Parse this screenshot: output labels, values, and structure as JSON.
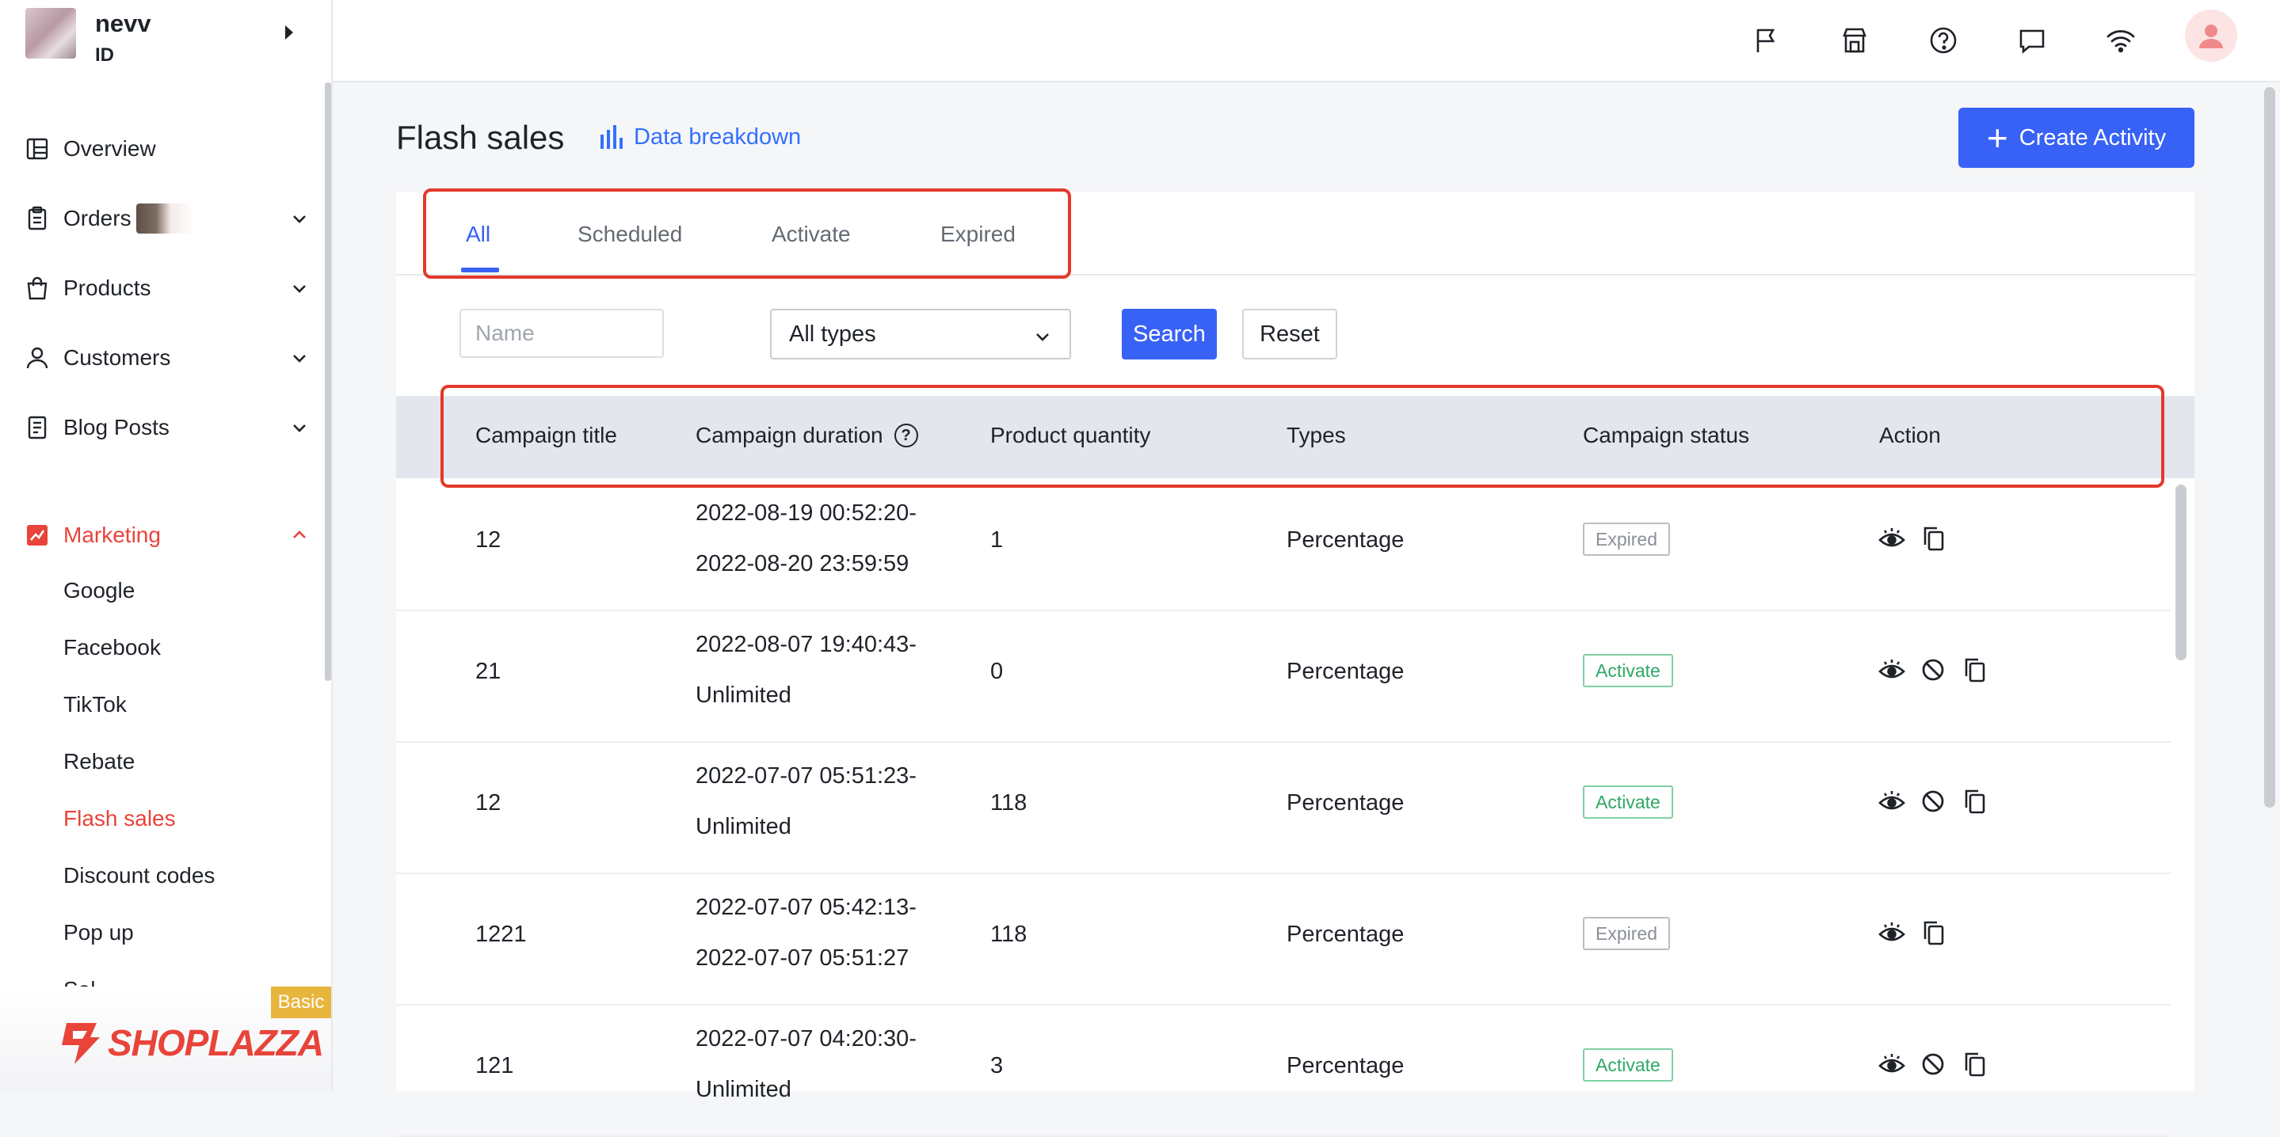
{
  "store": {
    "name": "nevv",
    "id_label": "ID"
  },
  "sidebar": {
    "items": [
      {
        "label": "Overview",
        "icon": "overview-icon"
      },
      {
        "label": "Orders",
        "icon": "orders-icon"
      },
      {
        "label": "Products",
        "icon": "products-icon"
      },
      {
        "label": "Customers",
        "icon": "customers-icon"
      },
      {
        "label": "Blog Posts",
        "icon": "blog-icon"
      },
      {
        "label": "Marketing",
        "icon": "marketing-icon",
        "active": true
      }
    ],
    "marketing_sub": [
      "Google",
      "Facebook",
      "TikTok",
      "Rebate",
      "Flash sales",
      "Discount codes",
      "Pop up",
      "Sal"
    ],
    "active_sub": "Flash sales"
  },
  "footer": {
    "plan": "Basic",
    "logo": "SHOPLAZZA"
  },
  "topbar": {
    "icons": [
      "flag-icon",
      "store-icon",
      "help-icon",
      "chat-icon",
      "wifi-icon",
      "user-avatar-icon"
    ]
  },
  "page": {
    "title": "Flash sales",
    "breakdown_label": "Data breakdown",
    "create_label": "Create Activity"
  },
  "tabs": [
    "All",
    "Scheduled",
    "Activate",
    "Expired"
  ],
  "active_tab": "All",
  "filters": {
    "name_placeholder": "Name",
    "type_value": "All types",
    "search_label": "Search",
    "reset_label": "Reset"
  },
  "table": {
    "headers": [
      "Campaign title",
      "Campaign duration",
      "Product quantity",
      "Types",
      "Campaign status",
      "Action"
    ],
    "rows": [
      {
        "title": "12",
        "start": "2022-08-19 00:52:20-",
        "end": "2022-08-20 23:59:59",
        "qty": "1",
        "type": "Percentage",
        "status": "Expired"
      },
      {
        "title": "21",
        "start": "2022-08-07 19:40:43-",
        "end": "Unlimited",
        "qty": "0",
        "type": "Percentage",
        "status": "Activate"
      },
      {
        "title": "12",
        "start": "2022-07-07 05:51:23-",
        "end": "Unlimited",
        "qty": "118",
        "type": "Percentage",
        "status": "Activate"
      },
      {
        "title": "1221",
        "start": "2022-07-07 05:42:13-",
        "end": "2022-07-07 05:51:27",
        "qty": "118",
        "type": "Percentage",
        "status": "Expired"
      },
      {
        "title": "121",
        "start": "2022-07-07 04:20:30-",
        "end": "Unlimited",
        "qty": "3",
        "type": "Percentage",
        "status": "Activate"
      }
    ]
  },
  "colors": {
    "accent": "#3861f6",
    "brand_red": "#e8443a",
    "highlight_box": "#e2392b",
    "activate": "#2ea866",
    "expired": "#8a8f99"
  }
}
